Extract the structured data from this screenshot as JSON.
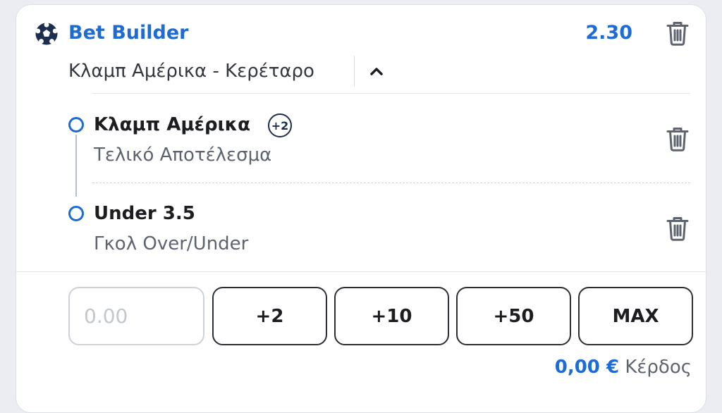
{
  "header": {
    "icon": "soccer-ball-icon",
    "title": "Bet Builder",
    "odds": "2.30",
    "delete_icon": "trash-icon"
  },
  "match": {
    "name": "Κλαμπ Αμέρικα - Κερέταρο",
    "toggle_icon": "chevron-up-icon"
  },
  "legs": [
    {
      "selection": "Κλαμπ Αμέρικα",
      "badge": "+2",
      "market": "Τελικό Αποτέλεσμα",
      "delete_icon": "trash-icon"
    },
    {
      "selection": "Under 3.5",
      "market": "Γκολ Over/Under",
      "delete_icon": "trash-icon"
    }
  ],
  "stake": {
    "placeholder": "0.00",
    "value": ""
  },
  "quick_stakes": [
    "+2",
    "+10",
    "+50",
    "MAX"
  ],
  "profit": {
    "amount": "0,00 €",
    "label": "Κέρδος"
  },
  "colors": {
    "accent": "#1e6bd4",
    "text_primary": "#1b1d21",
    "text_secondary": "#5d6470",
    "border": "#dcdfe6"
  }
}
